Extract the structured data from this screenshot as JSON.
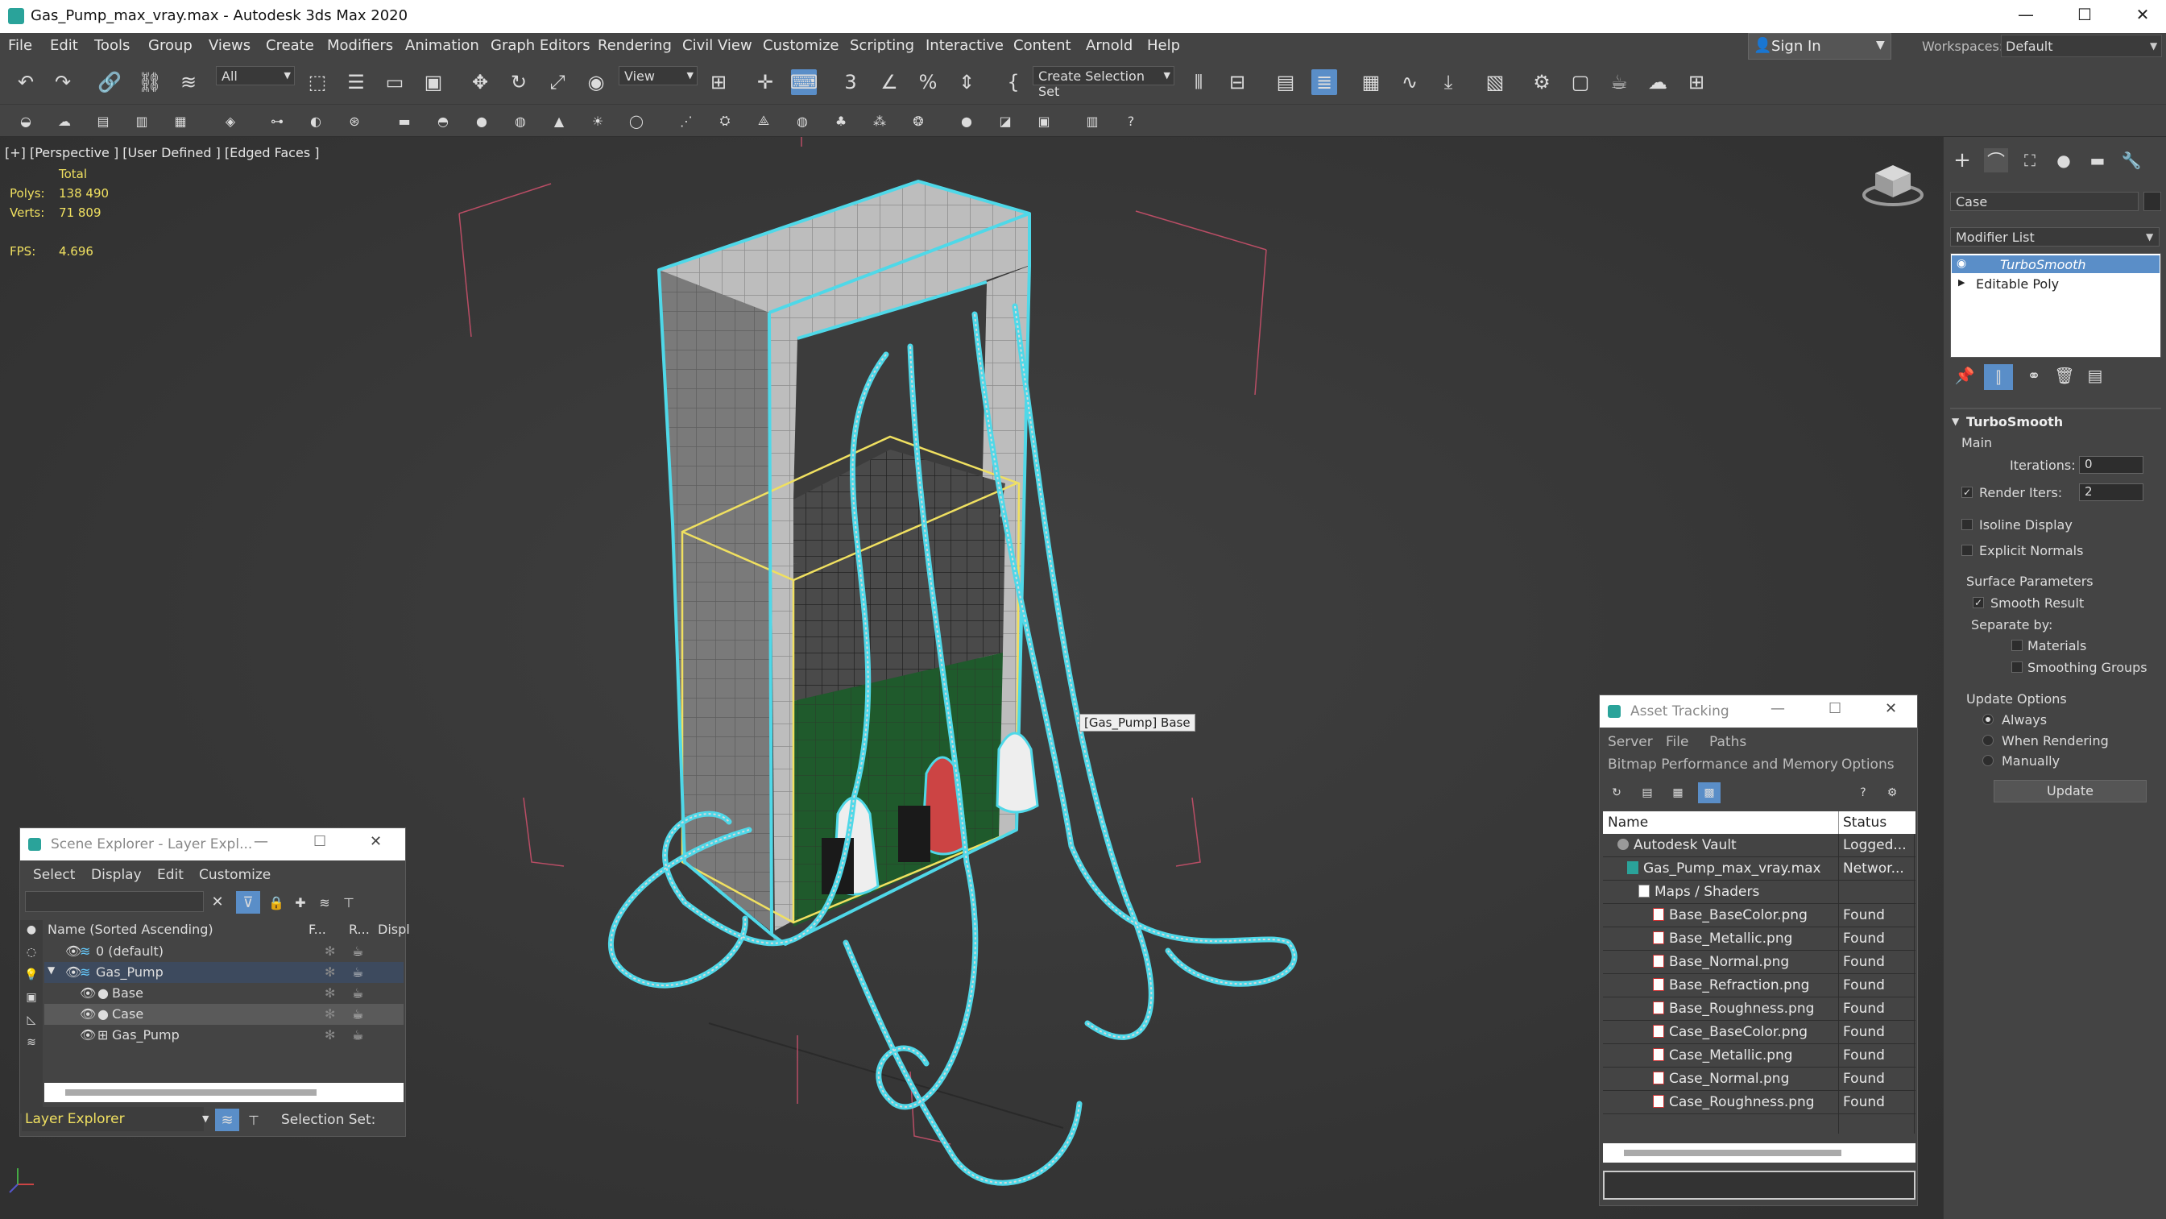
{
  "window": {
    "title": "Gas_Pump_max_vray.max - Autodesk 3ds Max 2020",
    "minimize": "—",
    "maximize": "☐",
    "close": "✕"
  },
  "menu": [
    "File",
    "Edit",
    "Tools",
    "Group",
    "Views",
    "Create",
    "Modifiers",
    "Animation",
    "Graph Editors",
    "Rendering",
    "Civil View",
    "Customize",
    "Scripting",
    "Interactive",
    "Content",
    "Arnold",
    "Help"
  ],
  "signin": {
    "label": "Sign In"
  },
  "workspace": {
    "label": "Workspaces:",
    "value": "Default"
  },
  "toolbar": {
    "filter": "All",
    "refcoord": "View",
    "selection_set": "Create Selection Set"
  },
  "viewport": {
    "label": "[+] [Perspective ] [User Defined ] [Edged Faces ]",
    "stats_header": "Total",
    "polys_label": "Polys:",
    "polys_value": "138 490",
    "verts_label": "Verts:",
    "verts_value": "71 809",
    "fps_label": "FPS:",
    "fps_value": "4.696",
    "tooltip": "[Gas_Pump] Base"
  },
  "command_panel": {
    "object_name": "Case",
    "modifier_list": "Modifier List",
    "stack": [
      "TurboSmooth",
      "Editable Poly"
    ],
    "rollout_title": "TurboSmooth",
    "main_label": "Main",
    "iterations_label": "Iterations:",
    "iterations_value": "0",
    "render_iters_label": "Render Iters:",
    "render_iters_value": "2",
    "isoline": "Isoline Display",
    "explicit_normals": "Explicit Normals",
    "surface_params": "Surface Parameters",
    "smooth_result": "Smooth Result",
    "separate_by": "Separate by:",
    "materials": "Materials",
    "smoothing_groups": "Smoothing Groups",
    "update_options": "Update Options",
    "always": "Always",
    "when_rendering": "When Rendering",
    "manually": "Manually",
    "update_button": "Update"
  },
  "scene_explorer": {
    "title": "Scene Explorer - Layer Expl...",
    "menu": [
      "Select",
      "Display",
      "Edit",
      "Customize"
    ],
    "columns": [
      "Name (Sorted Ascending)",
      "F...",
      "R...",
      "Displ"
    ],
    "rows": [
      "0 (default)",
      "Gas_Pump",
      "Base",
      "Case",
      "Gas_Pump"
    ],
    "footer_mode": "Layer Explorer",
    "selection_set": "Selection Set:"
  },
  "asset_tracking": {
    "title": "Asset Tracking",
    "menu": [
      "Server",
      "File",
      "Paths"
    ],
    "menu2": [
      "Bitmap Performance and Memory",
      "Options"
    ],
    "columns": [
      "Name",
      "Status"
    ],
    "rows": [
      {
        "name": "Autodesk Vault",
        "status": "Logged..."
      },
      {
        "name": "Gas_Pump_max_vray.max",
        "status": "Networ..."
      },
      {
        "name": "Maps / Shaders",
        "status": ""
      },
      {
        "name": "Base_BaseColor.png",
        "status": "Found"
      },
      {
        "name": "Base_Metallic.png",
        "status": "Found"
      },
      {
        "name": "Base_Normal.png",
        "status": "Found"
      },
      {
        "name": "Base_Refraction.png",
        "status": "Found"
      },
      {
        "name": "Base_Roughness.png",
        "status": "Found"
      },
      {
        "name": "Case_BaseColor.png",
        "status": "Found"
      },
      {
        "name": "Case_Metallic.png",
        "status": "Found"
      },
      {
        "name": "Case_Normal.png",
        "status": "Found"
      },
      {
        "name": "Case_Roughness.png",
        "status": "Found"
      }
    ]
  },
  "colors": {
    "selection_cyan": "#4fd8e8",
    "bbox_yellow": "#f0e060",
    "active_blue": "#5a8ec8",
    "viewport_bg": "#3a3a3a"
  }
}
